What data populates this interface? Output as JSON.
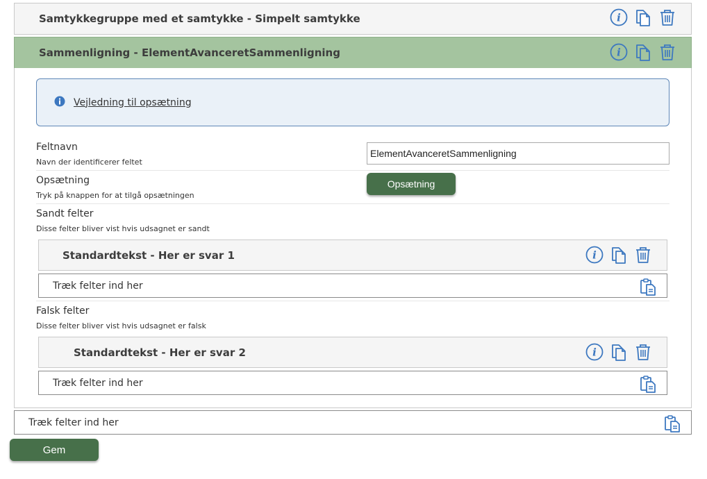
{
  "group1": {
    "title": "Samtykkegruppe med et samtykke - Simpelt samtykke"
  },
  "group2": {
    "title": "Sammenligning - ElementAvanceretSammenligning"
  },
  "guide": {
    "link_text": "Vejledning til opsætning"
  },
  "fields": {
    "feltnavn": {
      "label": "Feltnavn",
      "help": "Navn der identificerer feltet",
      "value": "ElementAvanceretSammenligning"
    },
    "opsaetning": {
      "label": "Opsætning",
      "help": "Tryk på knappen for at tilgå opsætningen",
      "button_label": "Opsætning"
    },
    "sandt": {
      "label": "Sandt felter",
      "help": "Disse felter bliver vist hvis udsagnet er sandt",
      "item_title": "Standardtekst - Her er svar 1",
      "dropzone_label": "Træk felter ind her"
    },
    "falsk": {
      "label": "Falsk felter",
      "help": "Disse felter bliver vist hvis udsagnet er falsk",
      "item_title": "Standardtekst - Her er svar 2",
      "dropzone_label": "Træk felter ind her"
    }
  },
  "outer_dropzone": {
    "label": "Træk felter ind her"
  },
  "save_button": {
    "label": "Gem"
  },
  "icons": {
    "info": "info-circle-icon",
    "copy": "copy-icon",
    "delete": "trash-icon",
    "paste": "clipboard-paste-icon"
  },
  "colors": {
    "icon_blue": "#3d78c0",
    "green_header": "#a4c49f",
    "button_green": "#47704a",
    "guide_bg": "#eaf1f8",
    "guide_border": "#5d86b7"
  }
}
